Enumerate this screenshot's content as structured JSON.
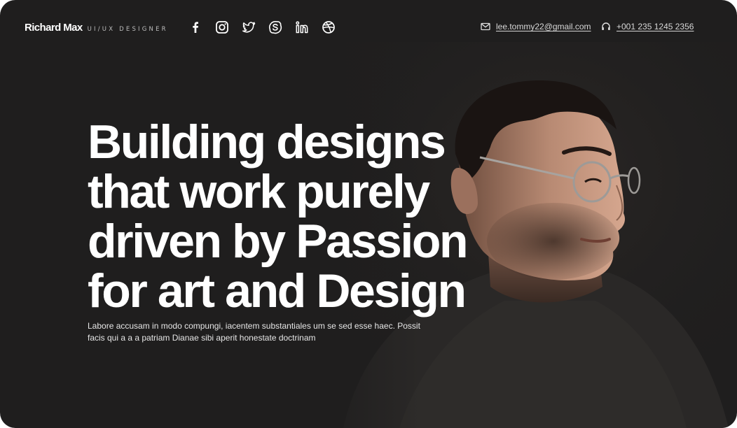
{
  "header": {
    "brand_name": "Richard Max",
    "brand_role": "UI/UX DESIGNER",
    "socials": [
      {
        "icon": "facebook-icon"
      },
      {
        "icon": "instagram-icon"
      },
      {
        "icon": "twitter-icon"
      },
      {
        "icon": "skype-icon"
      },
      {
        "icon": "linkedin-icon"
      },
      {
        "icon": "dribbble-icon"
      }
    ],
    "email": "lee.tommy22@gmail.com",
    "phone": "+001 235 1245 2356"
  },
  "hero": {
    "title_lines": [
      "Building designs",
      "that work purely",
      "driven by Passion",
      "for art and Design"
    ],
    "subtitle": "Labore accusam in modo compungi, iacentem substantiales um se sed esse haec. Possit facis qui a a a patriam Dianae sibi aperit honestate doctrinam"
  },
  "colors": {
    "background": "#1f1e1e",
    "text": "#ffffff"
  }
}
